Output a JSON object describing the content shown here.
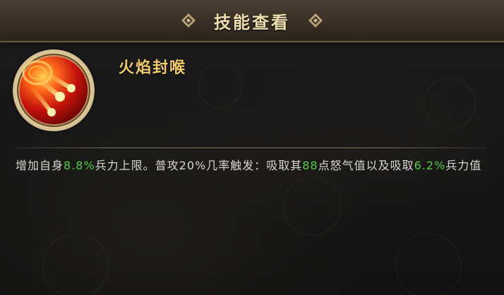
{
  "header": {
    "title": "技能查看"
  },
  "skill": {
    "name": "火焰封喉",
    "icon": "fire-skill-icon",
    "description": {
      "p1": "增加自身",
      "v1": "8.8%",
      "p2": "兵力上限。普攻20%几率触发：吸取其",
      "v2": "88",
      "p3": "点怒气值以及吸取",
      "v3": "6.2%",
      "p4": "兵力值"
    }
  },
  "colors": {
    "title": "#f0dfae",
    "skill_name": "#f2c96a",
    "highlight": "#4fcf3b",
    "text": "#d8d6d0"
  }
}
